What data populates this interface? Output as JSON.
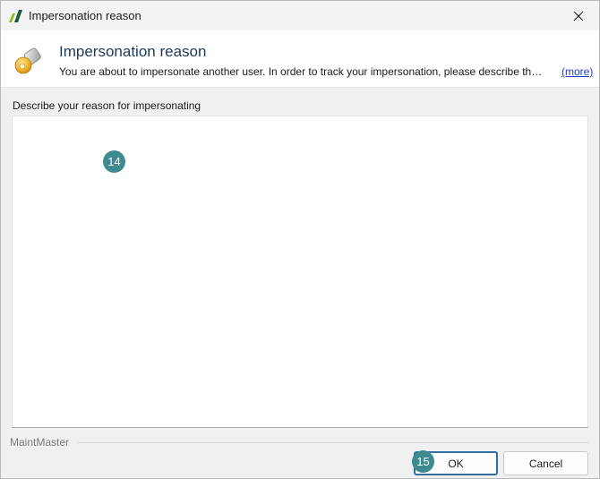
{
  "window": {
    "title": "Impersonation reason"
  },
  "header": {
    "title": "Impersonation reason",
    "description": "You are about to impersonate another user. In order to track your impersonation, please describe the reason for impersonating.",
    "more_link": "(more)"
  },
  "form": {
    "label": "Describe your reason for impersonating",
    "value": "",
    "placeholder": ""
  },
  "footer": {
    "brand": "MaintMaster",
    "ok_label": "OK",
    "cancel_label": "Cancel"
  },
  "markers": {
    "reason_field": "14",
    "ok_button": "15"
  },
  "icons": {
    "app": "maintmaster-logo-icon",
    "header": "key-icon",
    "close": "close-icon"
  },
  "colors": {
    "marker": "#3f8a8f",
    "link": "#1f3ec0",
    "ok_border": "#2f6fa3",
    "header_title": "#1e3a57"
  }
}
